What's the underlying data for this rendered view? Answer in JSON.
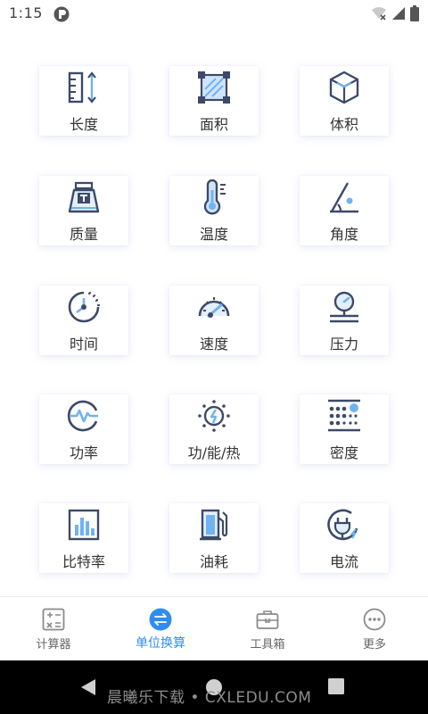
{
  "status": {
    "time": "1:15"
  },
  "units": [
    {
      "label": "长度",
      "icon": "ruler-icon"
    },
    {
      "label": "面积",
      "icon": "area-square-icon"
    },
    {
      "label": "体积",
      "icon": "cube-icon"
    },
    {
      "label": "质量",
      "icon": "weight-icon"
    },
    {
      "label": "温度",
      "icon": "thermometer-icon"
    },
    {
      "label": "角度",
      "icon": "angle-icon"
    },
    {
      "label": "时间",
      "icon": "clock-icon"
    },
    {
      "label": "速度",
      "icon": "speedometer-icon"
    },
    {
      "label": "压力",
      "icon": "pressure-gauge-icon"
    },
    {
      "label": "功率",
      "icon": "power-lightning-icon"
    },
    {
      "label": "功/能/热",
      "icon": "energy-sun-icon"
    },
    {
      "label": "密度",
      "icon": "density-dots-icon"
    },
    {
      "label": "比特率",
      "icon": "bitrate-bars-icon"
    },
    {
      "label": "油耗",
      "icon": "fuel-pump-icon"
    },
    {
      "label": "电流",
      "icon": "plug-icon"
    }
  ],
  "nav": {
    "items": [
      {
        "label": "计算器",
        "icon": "calculator-icon",
        "active": false
      },
      {
        "label": "单位换算",
        "icon": "convert-icon",
        "active": true
      },
      {
        "label": "工具箱",
        "icon": "toolbox-icon",
        "active": false
      },
      {
        "label": "更多",
        "icon": "more-icon",
        "active": false
      }
    ]
  },
  "system_bar": {
    "watermark": "晨曦乐下载 • CXLEDU.COM"
  },
  "colors": {
    "accent": "#2e8ef0",
    "icon_dark": "#3d4a68",
    "icon_light": "#6fb3f2"
  }
}
